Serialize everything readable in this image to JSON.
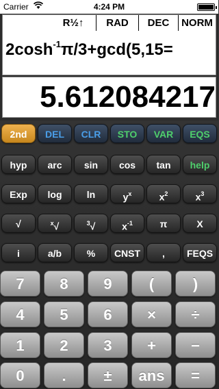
{
  "status": {
    "carrier": "Carrier",
    "time": "4:24 PM"
  },
  "modes": [
    "R½↑",
    "RAD",
    "DEC",
    "NORM"
  ],
  "display": {
    "expression_parts": [
      "2cosh",
      "-1",
      "π/3+gcd(5,15="
    ],
    "result": "5.612084217"
  },
  "colors": {
    "accent_orange": "#e0a13c",
    "blue_label": "#4a9ee8",
    "green_label": "#4fcf6c"
  },
  "rows": {
    "row1": [
      "2nd",
      "DEL",
      "CLR",
      "STO",
      "VAR",
      "EQS"
    ],
    "row2": [
      "hyp",
      "arc",
      "sin",
      "cos",
      "tan",
      "help"
    ],
    "row3": [
      "Exp",
      "log",
      "ln",
      "y",
      "x",
      "x"
    ],
    "row3_sup": [
      "",
      "",
      "",
      "x",
      "2",
      "3"
    ],
    "row4": [
      "√",
      "√",
      "√",
      "x",
      "π",
      "X"
    ],
    "row4_sup": [
      "",
      "x",
      "3",
      "-1",
      "",
      ""
    ],
    "row5": [
      "i",
      "a/b",
      "%",
      "CNST",
      ",",
      "FEQS"
    ],
    "num1": [
      "7",
      "8",
      "9",
      "(",
      ")"
    ],
    "num2": [
      "4",
      "5",
      "6",
      "×",
      "÷"
    ],
    "num3": [
      "1",
      "2",
      "3",
      "+",
      "−"
    ],
    "num4": [
      "0",
      ".",
      "±",
      "ans",
      "="
    ]
  }
}
